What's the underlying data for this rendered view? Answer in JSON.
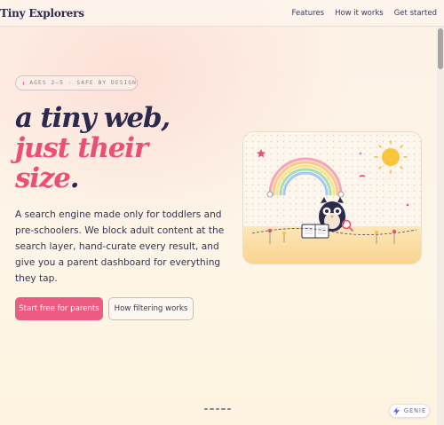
{
  "brand": "Tiny Explorers",
  "nav": [
    "Features",
    "How it works",
    "Get started"
  ],
  "badge": "AGES 2–5 · SAFE BY DESIGN",
  "headline": {
    "line1": "a tiny web,",
    "line2": "just their",
    "line3": "size",
    "period": "."
  },
  "lead": "A search engine made only for toddlers and pre-schoolers. We block adult content at the search layer, hand-curate every result, and give you a parent dashboard for everything they tap.",
  "cta_primary": "Start free for parents",
  "cta_secondary": "How filtering works",
  "assistant": "GENIE",
  "colors": {
    "accent": "#ec4f76",
    "ink": "#2b2a4c",
    "background": "#fdf3e7"
  }
}
